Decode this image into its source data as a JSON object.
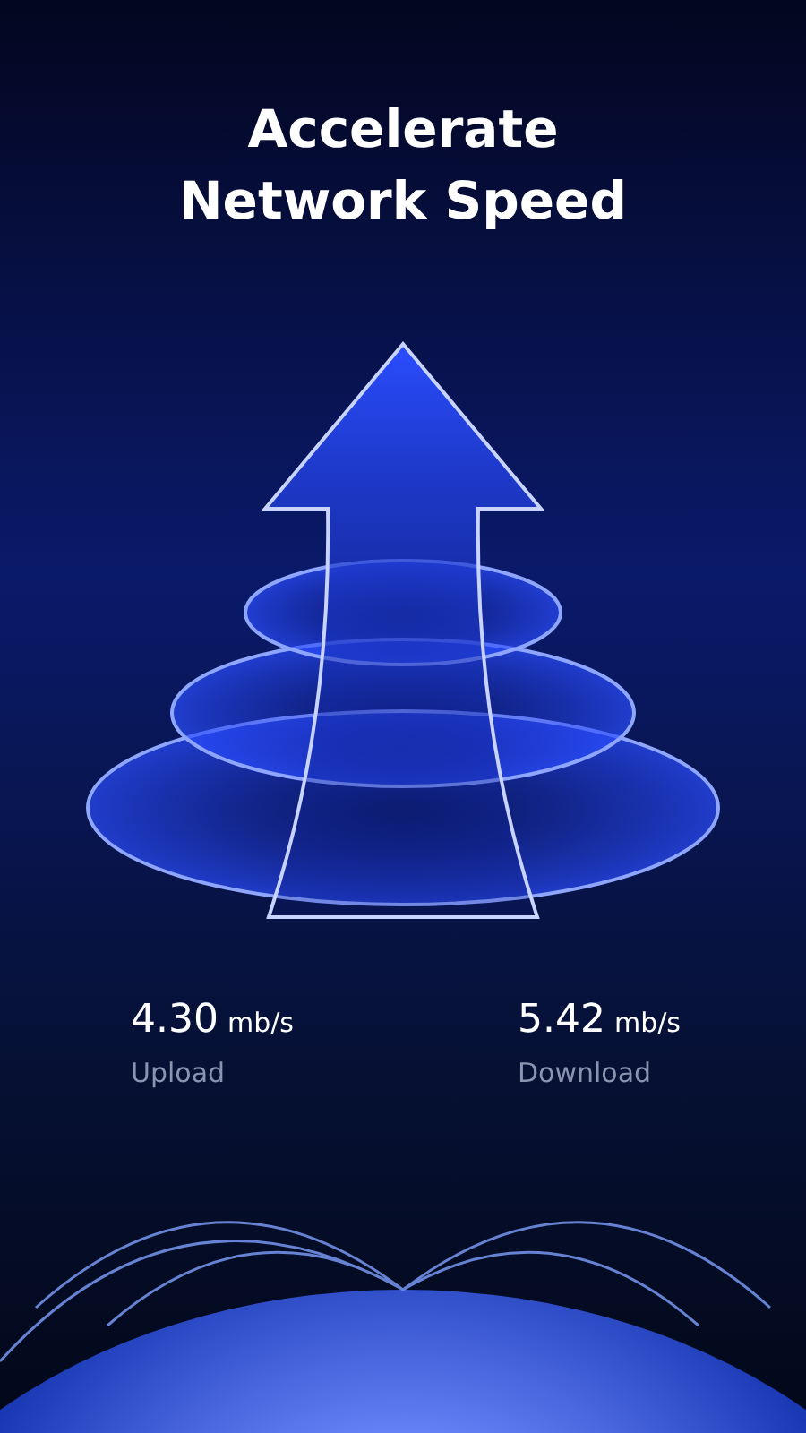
{
  "headline": [
    "Accelerate",
    "Network Speed"
  ],
  "stats": [
    {
      "value": "4.30",
      "unit": "mb/s",
      "label": "Upload"
    },
    {
      "value": "5.42",
      "unit": "mb/s",
      "label": "Download"
    }
  ]
}
